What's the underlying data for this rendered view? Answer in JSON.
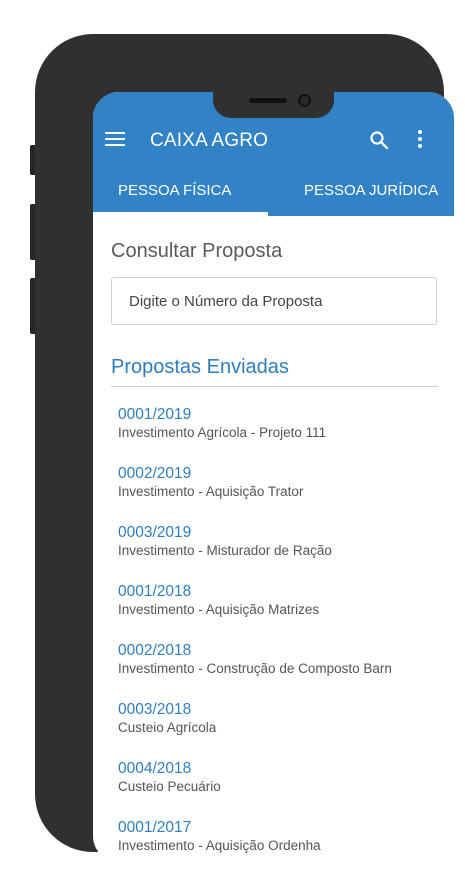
{
  "app": {
    "title": "CAIXA AGRO"
  },
  "icons": {
    "menu": "hamburger-menu-icon",
    "search": "search-icon",
    "more": "more-vert-icon"
  },
  "colors": {
    "primary": "#3282c6",
    "link": "#2f7ec0"
  },
  "tabs": [
    {
      "label": "PESSOA FÍSICA",
      "active": true
    },
    {
      "label": "PESSOA JURÍDICA",
      "active": false
    }
  ],
  "consult": {
    "title": "Consultar Proposta",
    "placeholder": "Digite o Número da Proposta"
  },
  "sent": {
    "title": "Propostas Enviadas",
    "items": [
      {
        "id": "0001/2019",
        "desc": "Investimento Agrícola - Projeto 111"
      },
      {
        "id": "0002/2019",
        "desc": "Investimento - Aquisição Trator"
      },
      {
        "id": "0003/2019",
        "desc": "Investimento - Misturador de Ração"
      },
      {
        "id": "0001/2018",
        "desc": "Investimento - Aquisição Matrizes"
      },
      {
        "id": "0002/2018",
        "desc": "Investimento - Construção de Composto Barn"
      },
      {
        "id": "0003/2018",
        "desc": "Custeio Agrícola"
      },
      {
        "id": "0004/2018",
        "desc": "Custeio Pecuário"
      },
      {
        "id": "0001/2017",
        "desc": "Investimento - Aquisição Ordenha"
      }
    ]
  }
}
